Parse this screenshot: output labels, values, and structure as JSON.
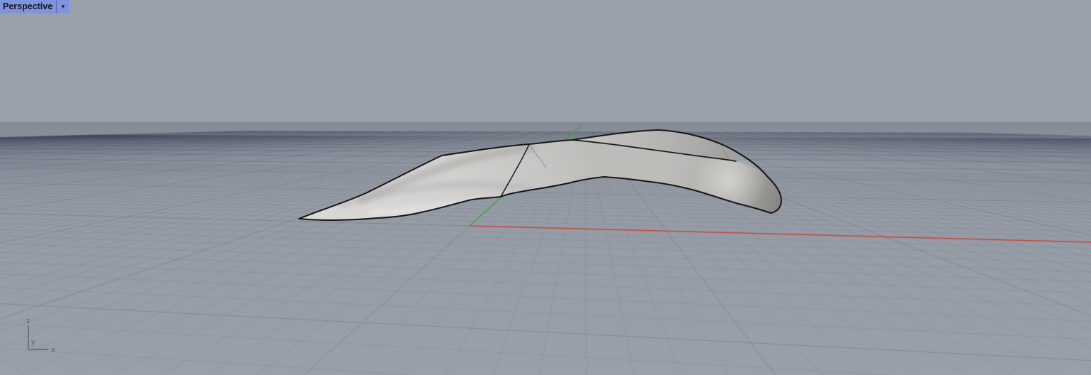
{
  "viewport": {
    "label": "Perspective",
    "dropdown_icon": "▼"
  },
  "gizmo": {
    "x_label": "x",
    "y_label": "y",
    "z_label": "z"
  },
  "colors": {
    "label_bg": "#7f94dd",
    "label_text": "#14141e",
    "label_divider": "#5a70bd",
    "sky": "#99a1aa",
    "ground_far": "#858b95",
    "ground_mid": "#959ba5",
    "ground_near": "#9aa0aa",
    "grid_minor": "rgba(48,58,74,0.09)",
    "grid_major": "rgba(42,52,68,0.20)",
    "x_axis": "#c8453a",
    "y_axis": "#3da63e",
    "surface_edge": "#161616",
    "gizmo_line": "#50565e",
    "gizmo_text": "#5d636b"
  }
}
